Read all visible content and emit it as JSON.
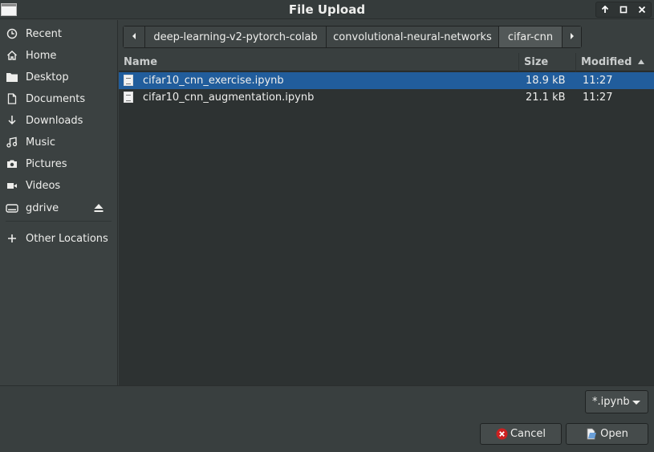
{
  "window": {
    "title": "File Upload"
  },
  "places": [
    {
      "label": "Recent",
      "icon": "clock-icon"
    },
    {
      "label": "Home",
      "icon": "home-icon"
    },
    {
      "label": "Desktop",
      "icon": "folder-icon"
    },
    {
      "label": "Documents",
      "icon": "document-icon"
    },
    {
      "label": "Downloads",
      "icon": "download-icon"
    },
    {
      "label": "Music",
      "icon": "music-icon"
    },
    {
      "label": "Pictures",
      "icon": "camera-icon"
    },
    {
      "label": "Videos",
      "icon": "video-icon"
    },
    {
      "label": "gdrive",
      "icon": "drive-icon"
    },
    {
      "label": "Other Locations",
      "icon": "plus-icon"
    }
  ],
  "path": [
    "deep-learning-v2-pytorch-colab",
    "convolutional-neural-networks",
    "cifar-cnn"
  ],
  "columns": {
    "name": "Name",
    "size": "Size",
    "modified": "Modified"
  },
  "files": [
    {
      "name": "cifar10_cnn_exercise.ipynb",
      "size": "18.9 kB",
      "modified": "11:27"
    },
    {
      "name": "cifar10_cnn_augmentation.ipynb",
      "size": "21.1 kB",
      "modified": "11:27"
    }
  ],
  "filter": {
    "value": "*.ipynb"
  },
  "buttons": {
    "cancel": "Cancel",
    "open": "Open"
  },
  "colors": {
    "selection": "#215d9c",
    "background": "#393f3f"
  }
}
